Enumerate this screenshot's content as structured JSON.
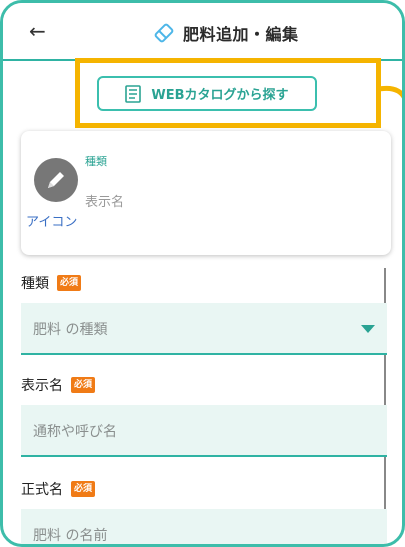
{
  "header": {
    "back_icon": "←",
    "title": "肥料追加・編集",
    "title_icon": "eraser-tag-icon"
  },
  "catalog_button": {
    "label": "WEBカタログから探す",
    "icon": "book-icon"
  },
  "preview_card": {
    "kind_label": "種類",
    "name_label": "表示名",
    "icon_label": "アイコン",
    "avatar_icon": "pencil-icon"
  },
  "fields": [
    {
      "label": "種類",
      "badge": "必須",
      "placeholder": "肥料 の種類",
      "type": "select"
    },
    {
      "label": "表示名",
      "badge": "必須",
      "placeholder": "通称や呼び名",
      "type": "text"
    },
    {
      "label": "正式名",
      "badge": "必須",
      "placeholder": "肥料 の名前",
      "type": "text"
    }
  ],
  "colors": {
    "accent": "#2fb3a3",
    "highlight": "#f5b400",
    "required_badge": "#f07b16",
    "input_bg": "#e9f6f3"
  }
}
